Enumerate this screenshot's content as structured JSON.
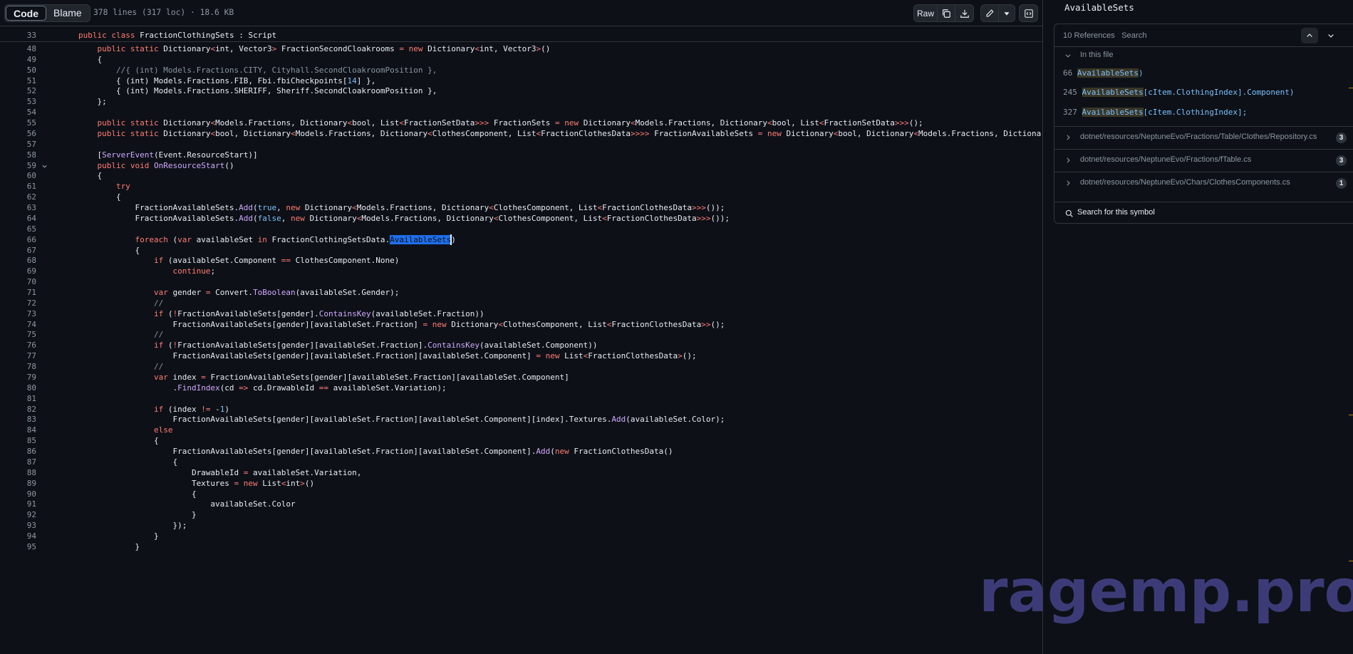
{
  "toolbar": {
    "tabs": [
      "Code",
      "Blame"
    ],
    "file_meta": "378 lines (317 loc) · 18.6 KB",
    "raw_label": "Raw",
    "icons": [
      "copy-icon",
      "download-icon",
      "pencil-icon",
      "caret-down-icon",
      "symbols-panel-icon"
    ]
  },
  "sticky": {
    "line_number": "33",
    "code": "public class FractionClothingSets : Script"
  },
  "code_lines": [
    {
      "n": "48",
      "t": "    public static Dictionary<int, Vector3> FractionSecondCloakrooms = new Dictionary<int, Vector3>()"
    },
    {
      "n": "49",
      "t": "    {"
    },
    {
      "n": "50",
      "t": "        //{ (int) Models.Fractions.CITY, Cityhall.SecondCloakroomPosition },"
    },
    {
      "n": "51",
      "t": "        { (int) Models.Fractions.FIB, Fbi.fbiCheckpoints[14] },"
    },
    {
      "n": "52",
      "t": "        { (int) Models.Fractions.SHERIFF, Sheriff.SecondCloakroomPosition },"
    },
    {
      "n": "53",
      "t": "    };"
    },
    {
      "n": "54",
      "t": ""
    },
    {
      "n": "55",
      "t": "    public static Dictionary<Models.Fractions, Dictionary<bool, List<FractionSetData>>> FractionSets = new Dictionary<Models.Fractions, Dictionary<bool, List<FractionSetData>>>();"
    },
    {
      "n": "56",
      "t": "    public static Dictionary<bool, Dictionary<Models.Fractions, Dictionary<ClothesComponent, List<FractionClothesData>>>> FractionAvailableSets = new Dictionary<bool, Dictionary<Models.Fractions, Dictionary<Clo"
    },
    {
      "n": "57",
      "t": ""
    },
    {
      "n": "58",
      "t": "    [ServerEvent(Event.ResourceStart)]"
    },
    {
      "n": "59",
      "t": "    public void OnResourceStart()"
    },
    {
      "n": "60",
      "t": "    {"
    },
    {
      "n": "61",
      "t": "        try"
    },
    {
      "n": "62",
      "t": "        {"
    },
    {
      "n": "63",
      "t": "            FractionAvailableSets.Add(true, new Dictionary<Models.Fractions, Dictionary<ClothesComponent, List<FractionClothesData>>>());"
    },
    {
      "n": "64",
      "t": "            FractionAvailableSets.Add(false, new Dictionary<Models.Fractions, Dictionary<ClothesComponent, List<FractionClothesData>>>());"
    },
    {
      "n": "65",
      "t": ""
    },
    {
      "n": "66",
      "t": "            foreach (var availableSet in FractionClothingSetsData.AvailableSets)"
    },
    {
      "n": "67",
      "t": "            {"
    },
    {
      "n": "68",
      "t": "                if (availableSet.Component == ClothesComponent.None)"
    },
    {
      "n": "69",
      "t": "                    continue;"
    },
    {
      "n": "70",
      "t": ""
    },
    {
      "n": "71",
      "t": "                var gender = Convert.ToBoolean(availableSet.Gender);"
    },
    {
      "n": "72",
      "t": "                //"
    },
    {
      "n": "73",
      "t": "                if (!FractionAvailableSets[gender].ContainsKey(availableSet.Fraction))"
    },
    {
      "n": "74",
      "t": "                    FractionAvailableSets[gender][availableSet.Fraction] = new Dictionary<ClothesComponent, List<FractionClothesData>>();"
    },
    {
      "n": "75",
      "t": "                //"
    },
    {
      "n": "76",
      "t": "                if (!FractionAvailableSets[gender][availableSet.Fraction].ContainsKey(availableSet.Component))"
    },
    {
      "n": "77",
      "t": "                    FractionAvailableSets[gender][availableSet.Fraction][availableSet.Component] = new List<FractionClothesData>();"
    },
    {
      "n": "78",
      "t": "                //"
    },
    {
      "n": "79",
      "t": "                var index = FractionAvailableSets[gender][availableSet.Fraction][availableSet.Component]"
    },
    {
      "n": "80",
      "t": "                    .FindIndex(cd => cd.DrawableId == availableSet.Variation);"
    },
    {
      "n": "81",
      "t": ""
    },
    {
      "n": "82",
      "t": "                if (index != -1)"
    },
    {
      "n": "83",
      "t": "                    FractionAvailableSets[gender][availableSet.Fraction][availableSet.Component][index].Textures.Add(availableSet.Color);"
    },
    {
      "n": "84",
      "t": "                else"
    },
    {
      "n": "85",
      "t": "                {"
    },
    {
      "n": "86",
      "t": "                    FractionAvailableSets[gender][availableSet.Fraction][availableSet.Component].Add(new FractionClothesData()"
    },
    {
      "n": "87",
      "t": "                    {"
    },
    {
      "n": "88",
      "t": "                        DrawableId = availableSet.Variation,"
    },
    {
      "n": "89",
      "t": "                        Textures = new List<int>()"
    },
    {
      "n": "90",
      "t": "                        {"
    },
    {
      "n": "91",
      "t": "                            availableSet.Color"
    },
    {
      "n": "92",
      "t": "                        }"
    },
    {
      "n": "93",
      "t": "                    });"
    },
    {
      "n": "94",
      "t": "                }"
    },
    {
      "n": "95",
      "t": "            }"
    }
  ],
  "selection": {
    "line": "66",
    "text": "AvailableSets"
  },
  "symbols": {
    "title": "AvailableSets",
    "references_count": "10 References",
    "search_label": "Search",
    "in_this_file": "In this file",
    "in_file_refs": [
      {
        "line": "66",
        "text": "AvailableSets)"
      },
      {
        "line": "245",
        "text": "AvailableSets[cItem.ClothingIndex].Component)"
      },
      {
        "line": "327",
        "text": "AvailableSets[cItem.ClothingIndex];"
      }
    ],
    "files": [
      {
        "path": "dotnet/resources/NeptuneEvo/Fractions/Table/Clothes/Repository.cs",
        "count": "3"
      },
      {
        "path": "dotnet/resources/NeptuneEvo/Fractions/fTable.cs",
        "count": "3"
      },
      {
        "path": "dotnet/resources/NeptuneEvo/Chars/ClothesComponents.cs",
        "count": "1"
      }
    ],
    "search_for_symbol": "Search for this symbol"
  },
  "watermark": "ragemp.pro",
  "colors": {
    "background": "#0d1117",
    "border": "#30363d",
    "keyword": "#ff7b72",
    "function": "#d2a8ff",
    "constant": "#79c0ff",
    "comment": "#8b949e",
    "selection": "#1f6feb",
    "watermark": "#48448c"
  }
}
